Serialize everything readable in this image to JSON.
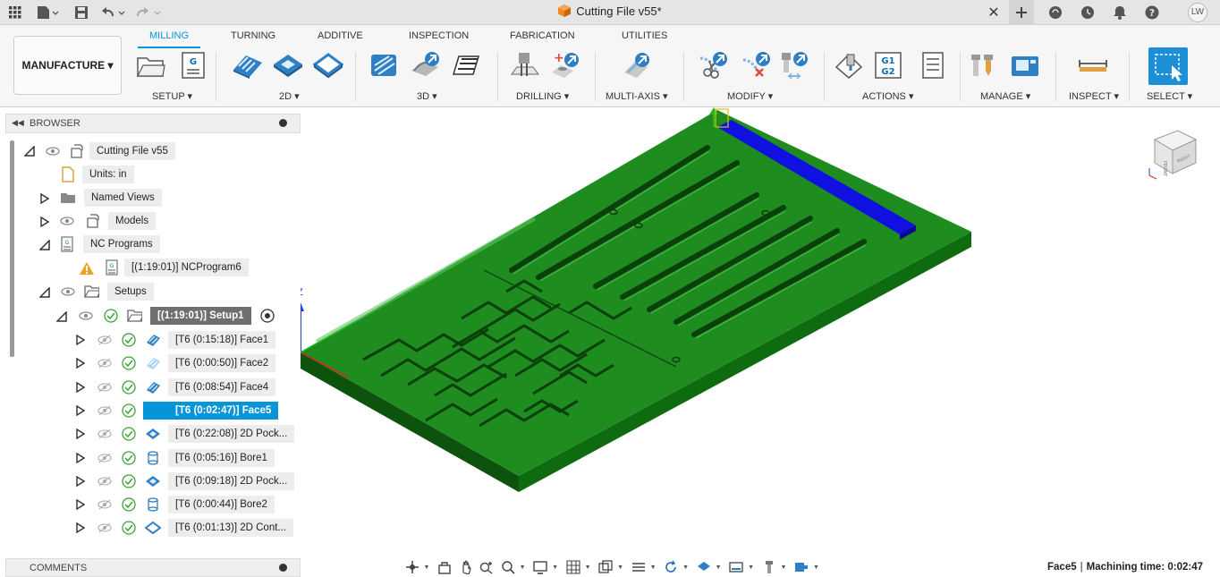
{
  "window": {
    "title": "Cutting File v55*",
    "user_initials": "LW"
  },
  "ribbon": {
    "workspace_label": "MANUFACTURE ▾",
    "tabs": [
      "MILLING",
      "TURNING",
      "ADDITIVE",
      "INSPECTION",
      "FABRICATION",
      "UTILITIES"
    ],
    "active_tab": "MILLING",
    "groups": [
      "SETUP ▾",
      "2D ▾",
      "3D ▾",
      "DRILLING ▾",
      "MULTI-AXIS ▾",
      "MODIFY ▾",
      "ACTIONS ▾",
      "MANAGE ▾",
      "INSPECT ▾",
      "SELECT ▾"
    ],
    "g_code_labels": [
      "G1",
      "G2"
    ]
  },
  "browser": {
    "title": "BROWSER",
    "nodes": {
      "root": "Cutting File v55",
      "units": "Units: in",
      "named_views": "Named Views",
      "models": "Models",
      "nc_programs": "NC Programs",
      "nc_program6": "[(1:19:01)] NCProgram6",
      "setups": "Setups",
      "setup1": "[(1:19:01)] Setup1",
      "ops": [
        "[T6 (0:15:18)] Face1",
        "[T6 (0:00:50)] Face2",
        "[T6 (0:08:54)] Face4",
        "[T6 (0:02:47)] Face5",
        "[T6 (0:22:08)] 2D Pock...",
        "[T6 (0:05:16)] Bore1",
        "[T6 (0:09:18)] 2D Pock...",
        "[T6 (0:00:44)] Bore2",
        "[T6 (0:01:13)] 2D Cont..."
      ]
    }
  },
  "comments": {
    "title": "COMMENTS"
  },
  "viewport": {
    "axis_label": "Z",
    "viewcube_faces": [
      "FRONT",
      "RIGHT"
    ],
    "colors": {
      "board": "#1e8a1e",
      "board_dark": "#0c4f0c",
      "selected_face": "#1010e0",
      "axis_x": "#e02020",
      "axis_y": "#22b822",
      "axis_z": "#2040d0"
    }
  },
  "status": {
    "selection": "Face5",
    "separator": "|",
    "machining_label": "Machining time: 0:02:47"
  }
}
